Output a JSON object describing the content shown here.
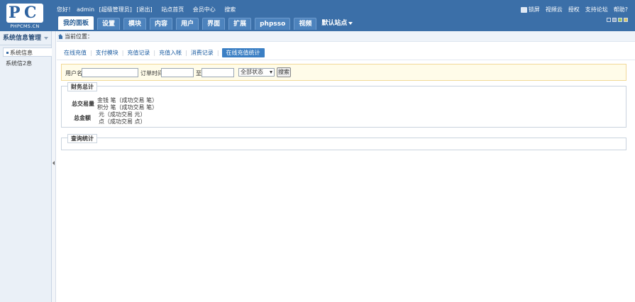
{
  "header": {
    "logo_text": "PHPCMS.CN",
    "greeting": "您好！",
    "username": "admin",
    "role": "[超级管理员]",
    "logout": "[退出]",
    "site_home": "站点首页",
    "member_center": "会员中心",
    "search": "搜索",
    "right_links": [
      "锁屏",
      "视频云",
      "授权",
      "支持论坛",
      "帮助?"
    ],
    "nav_tabs": [
      "我的面板",
      "设置",
      "模块",
      "内容",
      "用户",
      "界面",
      "扩展",
      "phpsso",
      "视频"
    ],
    "site_selector": "默认站点"
  },
  "sidebar": {
    "title": "系统信息管理",
    "items": [
      "系统信息",
      "系统信2息"
    ]
  },
  "breadcrumb": {
    "label": "当前位置："
  },
  "subnav": {
    "items": [
      "在线充值",
      "支付模块",
      "充值记录",
      "充值入帐",
      "消费记录"
    ],
    "active": "在线充值统计"
  },
  "search": {
    "username_label": "用户名",
    "order_time_label": "订单时间",
    "to_label": "至",
    "status_select": "全部状态",
    "search_button": "搜索"
  },
  "finance": {
    "legend": "财务总计",
    "total_volume_label": "总交易量",
    "money_line": "金钱    笔（成功交易    笔）",
    "points_line": "积分    笔（成功交易    笔）",
    "total_amount_label": "总金额",
    "yuan_line": "元（成功交易    元）",
    "dian_line": "点（成功交易    点）"
  },
  "query": {
    "legend": "查询统计"
  }
}
